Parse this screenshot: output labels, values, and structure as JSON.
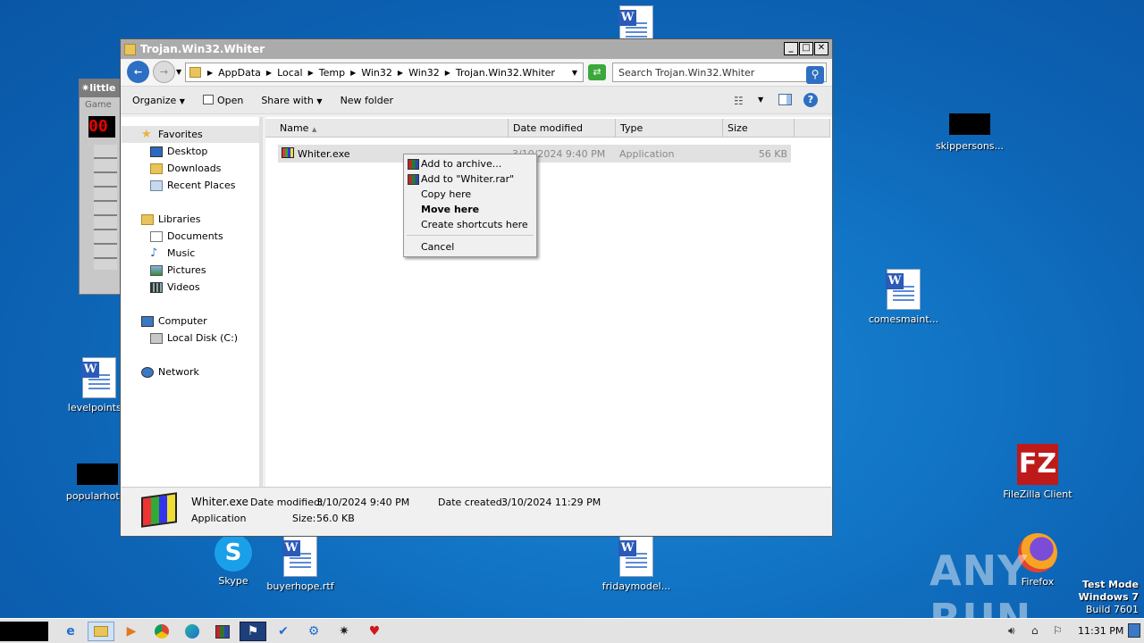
{
  "desktop": {
    "icons": [
      {
        "label": "levelpoints...",
        "type": "doc"
      },
      {
        "label": "popularhot...",
        "type": "black"
      },
      {
        "label": "Skype",
        "type": "skype"
      },
      {
        "label": "buyerhope.rtf",
        "type": "doc"
      },
      {
        "label": "fridaymodel...",
        "type": "doc"
      },
      {
        "label": "skippersons...",
        "type": "black"
      },
      {
        "label": "comesmaint...",
        "type": "doc"
      },
      {
        "label": "FileZilla Client",
        "type": "filezilla"
      },
      {
        "label": "Firefox",
        "type": "firefox"
      }
    ],
    "watermark": "ANY RUN",
    "test_mode": {
      "line1": "Test Mode",
      "line2": "Windows 7",
      "line3": "Build 7601"
    }
  },
  "game_window": {
    "title": "little",
    "menu": "Game",
    "counter": "00"
  },
  "explorer": {
    "title": "Trojan.Win32.Whiter",
    "breadcrumbs": [
      "AppData",
      "Local",
      "Temp",
      "Win32",
      "Win32",
      "Trojan.Win32.Whiter"
    ],
    "search_placeholder": "Search Trojan.Win32.Whiter",
    "toolbar": {
      "organize": "Organize",
      "open": "Open",
      "share_with": "Share with",
      "new_folder": "New folder"
    },
    "nav": {
      "favorites": "Favorites",
      "favorites_items": [
        "Desktop",
        "Downloads",
        "Recent Places"
      ],
      "libraries": "Libraries",
      "libraries_items": [
        "Documents",
        "Music",
        "Pictures",
        "Videos"
      ],
      "computer": "Computer",
      "computer_items": [
        "Local Disk (C:)"
      ],
      "network": "Network"
    },
    "columns": {
      "name": "Name",
      "date_modified": "Date modified",
      "type": "Type",
      "size": "Size"
    },
    "file": {
      "name": "Whiter.exe",
      "date": "3/10/2024 9:40 PM",
      "type": "Application",
      "size": "56 KB"
    },
    "status": {
      "filename": "Whiter.exe",
      "date_modified_label": "Date modified:",
      "date_modified": "3/10/2024 9:40 PM",
      "date_created_label": "Date created:",
      "date_created": "3/10/2024 11:29 PM",
      "type": "Application",
      "size_label": "Size:",
      "size": "56.0 KB"
    }
  },
  "context_menu": {
    "items": [
      "Add to archive...",
      "Add to \"Whiter.rar\"",
      "Copy here",
      "Move here",
      "Create shortcuts here",
      "Cancel"
    ]
  },
  "taskbar": {
    "clock": "11:31 PM"
  }
}
